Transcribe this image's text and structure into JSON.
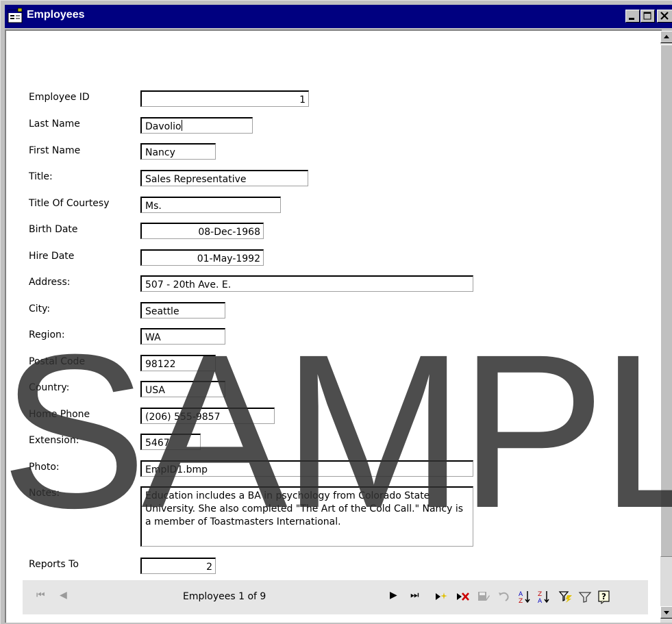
{
  "window": {
    "title": "Employees"
  },
  "fields": {
    "employee_id": {
      "label": "Employee ID",
      "value": "1"
    },
    "last_name": {
      "label": "Last Name",
      "value": "Davolio"
    },
    "first_name": {
      "label": "First Name",
      "value": "Nancy"
    },
    "title": {
      "label": "Title:",
      "value": "Sales Representative"
    },
    "title_of_courtesy": {
      "label": "Title Of Courtesy",
      "value": "Ms."
    },
    "birth_date": {
      "label": "Birth Date",
      "value": "08-Dec-1968"
    },
    "hire_date": {
      "label": "Hire Date",
      "value": "01-May-1992"
    },
    "address": {
      "label": "Address:",
      "value": "507 - 20th Ave. E."
    },
    "city": {
      "label": "City:",
      "value": "Seattle"
    },
    "region": {
      "label": "Region:",
      "value": "WA"
    },
    "postal_code": {
      "label": "Postal Code",
      "value": "98122"
    },
    "country": {
      "label": "Country:",
      "value": "USA"
    },
    "home_phone": {
      "label": "Home Phone",
      "value": "(206) 555-9857"
    },
    "extension": {
      "label": "Extension:",
      "value": "5467"
    },
    "photo": {
      "label": "Photo:",
      "value": "EmpID1.bmp"
    },
    "notes": {
      "label": "Notes:",
      "value": "Education includes a BA in psychology from Colorado State University.  She also completed \"The Art of the Cold Call.\"  Nancy is a member of Toastmasters International."
    },
    "reports_to": {
      "label": "Reports To",
      "value": "2"
    }
  },
  "navigation": {
    "record_status": "Employees 1 of 9",
    "first": "⏮",
    "prev": "◀",
    "next": "▶",
    "last": "⏭"
  },
  "watermark": "SAMPL",
  "colors": {
    "titlebar": "#000080",
    "navbar": "#e6e6e6",
    "watermark": "#303030"
  }
}
